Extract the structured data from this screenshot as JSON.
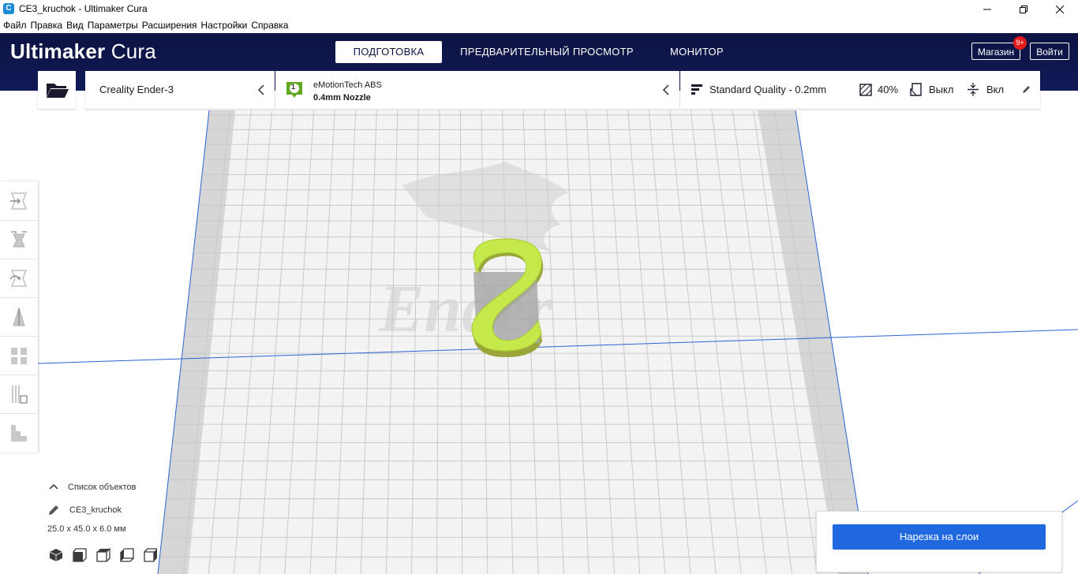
{
  "window": {
    "title": "CE3_kruchok - Ultimaker Cura",
    "icon": "cura-app-icon",
    "icon_glyph": "C"
  },
  "menu": [
    "Файл",
    "Правка",
    "Вид",
    "Параметры",
    "Расширения",
    "Настройки",
    "Справка"
  ],
  "brand": {
    "strong": "Ultimaker",
    "light": "Cura"
  },
  "stages": [
    {
      "label": "ПОДГОТОВКА",
      "active": true
    },
    {
      "label": "ПРЕДВАРИТЕЛЬНЫЙ ПРОСМОТР",
      "active": false
    },
    {
      "label": "МОНИТОР",
      "active": false
    }
  ],
  "header_buttons": {
    "marketplace": "Магазин",
    "badge": "9+",
    "login": "Войти"
  },
  "printer": {
    "name": "Creality Ender-3"
  },
  "material": {
    "extruder": "1",
    "name": "eMotionTech ABS",
    "nozzle": "0.4mm Nozzle"
  },
  "print_settings": {
    "quality": "Standard Quality - 0.2mm",
    "infill": "40%",
    "support": "Выкл",
    "adhesion": "Вкл"
  },
  "tools": [
    "move-tool",
    "scale-tool",
    "rotate-tool",
    "mirror-tool",
    "per-model-settings-tool",
    "support-blocker-tool",
    "layer-view-tool"
  ],
  "object_list": {
    "header": "Список объектов",
    "object_name": "CE3_kruchok",
    "dimensions": "25.0 x 45.0 x 6.0 мм"
  },
  "view_buttons": [
    "3d-view",
    "front-view",
    "top-view",
    "left-view",
    "right-view"
  ],
  "buildplate_logo": "Ender",
  "slice_button": "Нарезка на слои",
  "colors": {
    "header_bg": "#0d1341",
    "accent_blue": "#2068e0",
    "model_color": "#c5e84a",
    "badge_red": "#e11a1a",
    "material_green": "#5fa820"
  }
}
